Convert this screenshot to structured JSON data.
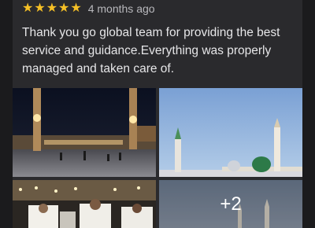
{
  "review": {
    "star_icons": [
      "star-icon",
      "star-icon",
      "star-icon",
      "star-icon",
      "star-icon"
    ],
    "star_color": "#f6c026",
    "rating": 5,
    "time_ago": "4 months ago",
    "text": "Thank you go global team for providing the best service and guidance.Everything was properly managed and taken care of."
  },
  "photos": {
    "more_count_label": "+2"
  }
}
